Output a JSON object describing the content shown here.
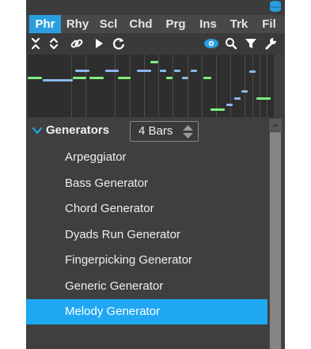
{
  "tabs": [
    {
      "label": "Phr",
      "active": true
    },
    {
      "label": "Rhy",
      "active": false
    },
    {
      "label": "Scl",
      "active": false
    },
    {
      "label": "Chd",
      "active": false
    },
    {
      "label": "Prg",
      "active": false
    },
    {
      "label": "Ins",
      "active": false
    },
    {
      "label": "Trk",
      "active": false
    },
    {
      "label": "Fil",
      "active": false
    }
  ],
  "toolbar": {
    "icons": [
      "collapse-all-icon",
      "expand-icon",
      "link-icon",
      "play-icon",
      "refresh-icon",
      "eye-icon",
      "search-icon",
      "filter-icon",
      "wrench-icon"
    ]
  },
  "colors": {
    "accent": "#2a9fe0",
    "selected": "#1fa7f2",
    "note_green": "#7ef07a",
    "note_blue": "#8cb8ea"
  },
  "generators": {
    "title": "Generators",
    "bars_value": "4 Bars",
    "items": [
      {
        "label": "Arpeggiator",
        "selected": false
      },
      {
        "label": "Bass Generator",
        "selected": false
      },
      {
        "label": "Chord Generator",
        "selected": false
      },
      {
        "label": "Dyads Run Generator",
        "selected": false
      },
      {
        "label": "Fingerpicking Generator",
        "selected": false
      },
      {
        "label": "Generic Generator",
        "selected": false
      },
      {
        "label": "Melody Generator",
        "selected": true
      }
    ]
  }
}
